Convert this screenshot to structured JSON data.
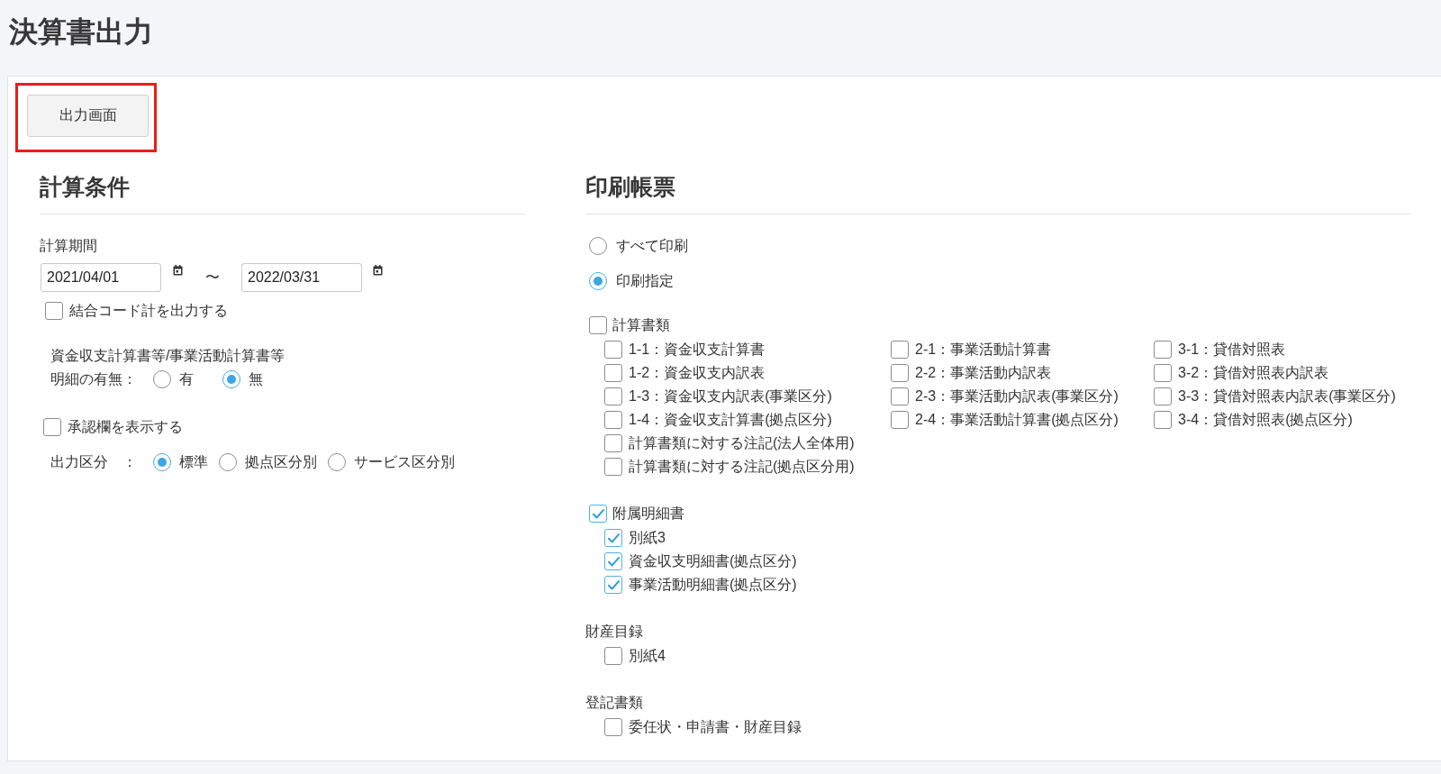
{
  "page_title": "決算書出力",
  "output_screen_button": {
    "label": "出力画面",
    "highlighted": true
  },
  "calculation_conditions": {
    "heading": "計算条件",
    "period": {
      "label": "計算期間",
      "from": "2021/04/01",
      "separator": "〜",
      "to": "2022/03/31"
    },
    "combined_code_total": {
      "label": "結合コード計を出力する",
      "checked": false
    },
    "detail_option": {
      "caption": "資金収支計算書等/事業活動計算書等",
      "label": "明細の有無：",
      "options": [
        {
          "label": "有",
          "selected": false
        },
        {
          "label": "無",
          "selected": true
        }
      ]
    },
    "approval_column": {
      "label": "承認欄を表示する",
      "checked": false
    },
    "output_division": {
      "label": "出力区分　：",
      "options": [
        {
          "label": "標準",
          "selected": true
        },
        {
          "label": "拠点区分別",
          "selected": false
        },
        {
          "label": "サービス区分別",
          "selected": false
        }
      ]
    }
  },
  "print_forms": {
    "heading": "印刷帳票",
    "print_mode": [
      {
        "label": "すべて印刷",
        "selected": false
      },
      {
        "label": "印刷指定",
        "selected": true
      }
    ],
    "groups": [
      {
        "kind": "checkbox",
        "label": "計算書類",
        "checked": false,
        "columns": [
          {
            "items": [
              {
                "label": "1-1：資金収支計算書",
                "checked": false
              },
              {
                "label": "1-2：資金収支内訳表",
                "checked": false
              },
              {
                "label": "1-3：資金収支内訳表(事業区分)",
                "checked": false
              },
              {
                "label": "1-4：資金収支計算書(拠点区分)",
                "checked": false
              },
              {
                "label": "計算書類に対する注記(法人全体用)",
                "checked": false
              },
              {
                "label": "計算書類に対する注記(拠点区分用)",
                "checked": false
              }
            ]
          },
          {
            "items": [
              {
                "label": "2-1：事業活動計算書",
                "checked": false
              },
              {
                "label": "2-2：事業活動内訳表",
                "checked": false
              },
              {
                "label": "2-3：事業活動内訳表(事業区分)",
                "checked": false
              },
              {
                "label": "2-4：事業活動計算書(拠点区分)",
                "checked": false
              }
            ]
          },
          {
            "items": [
              {
                "label": "3-1：貸借対照表",
                "checked": false
              },
              {
                "label": "3-2：貸借対照表内訳表",
                "checked": false
              },
              {
                "label": "3-3：貸借対照表内訳表(事業区分)",
                "checked": false
              },
              {
                "label": "3-4：貸借対照表(拠点区分)",
                "checked": false
              }
            ]
          }
        ]
      },
      {
        "kind": "checkbox",
        "label": "附属明細書",
        "checked": true,
        "columns": [
          {
            "items": [
              {
                "label": "別紙3",
                "checked": true
              },
              {
                "label": "資金収支明細書(拠点区分)",
                "checked": true
              },
              {
                "label": "事業活動明細書(拠点区分)",
                "checked": true
              }
            ]
          }
        ]
      },
      {
        "kind": "heading",
        "label": "財産目録",
        "columns": [
          {
            "items": [
              {
                "label": "別紙4",
                "checked": false
              }
            ]
          }
        ]
      },
      {
        "kind": "heading",
        "label": "登記書類",
        "columns": [
          {
            "items": [
              {
                "label": "委任状・申請書・財産目録",
                "checked": false
              }
            ]
          }
        ]
      }
    ]
  }
}
